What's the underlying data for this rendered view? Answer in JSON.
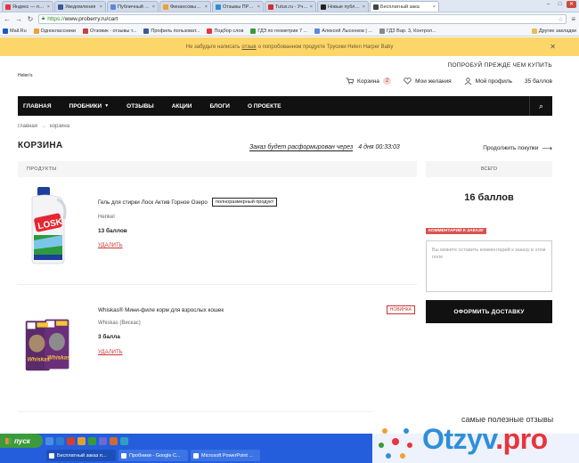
{
  "browser": {
    "tabs": [
      {
        "label": "Яндекс — поиск п",
        "color": "#e8343c",
        "active": false
      },
      {
        "label": "Уведомления",
        "color": "#3b5998",
        "active": false
      },
      {
        "label": "Публичный Старт",
        "color": "#5a8ad8",
        "active": false
      },
      {
        "label": "Финансовый фору",
        "color": "#f0a030",
        "active": false
      },
      {
        "label": "Отзывы ПРО - рос",
        "color": "#2f8fd8",
        "active": false
      },
      {
        "label": "Tutux.ru - Участн",
        "color": "#d03030",
        "active": false
      },
      {
        "label": "Новые публикаци",
        "color": "#222222",
        "active": false
      },
      {
        "label": "Бесплатный зака",
        "color": "#444444",
        "active": true
      }
    ],
    "url_protocol": "https://",
    "url_rest": "www.proberry.ru/cart",
    "bookmarks": [
      {
        "label": "Mail.Ru",
        "color": "#1a5bc4"
      },
      {
        "label": "Одноклассники",
        "color": "#f0a030"
      },
      {
        "label": "Отзовик - отзывы т...",
        "color": "#c84040"
      },
      {
        "label": "Профиль пользоват...",
        "color": "#3b5998"
      },
      {
        "label": "Подбор слов",
        "color": "#e8343c"
      },
      {
        "label": "ГДЗ по геометрии 7 ...",
        "color": "#3a9a3a"
      },
      {
        "label": "Алексей Лысенков | ...",
        "color": "#5a8ad8"
      },
      {
        "label": "ГДЗ Вар. 3, Контрол...",
        "color": "#888888"
      }
    ],
    "other_bookmarks": "Другие закладки"
  },
  "notice": {
    "before": "Не забудьте написать",
    "link": "отзыв",
    "after": "о попробованном продукте Трусики Helen Harper Baby"
  },
  "header": {
    "logo_text": "Helen's",
    "tagline": "ПОПРОБУЙ ПРЕЖДЕ ЧЕМ КУПИТЬ",
    "cart_label": "Корзина",
    "cart_count": "2",
    "wishlist_label": "Мои желания",
    "profile_label": "Мой профиль",
    "points_label": "35 баллов"
  },
  "nav": {
    "items": [
      "ГЛАВНАЯ",
      "ПРОБНИКИ",
      "ОТЗЫВЫ",
      "АКЦИИ",
      "БЛОГИ",
      "О ПРОЕКТЕ"
    ]
  },
  "breadcrumbs": [
    "главная",
    "корзина"
  ],
  "page": {
    "title": "КОРЗИНА",
    "timer_label": "Заказ будет расформирован через",
    "timer_value": "4 дня 00:33:03",
    "continue_label": "Продолжить покупки"
  },
  "products_header": "ПРОДУКТЫ",
  "products": [
    {
      "name": "Гель для стирки Лоск Актив Горное Озеро",
      "tag": "полноразмерный продукт",
      "brand": "Henkel",
      "points": "13 баллов",
      "remove": "УДАЛИТЬ"
    },
    {
      "name": "Whiskas® Мини-филе корм для взрослых кошек",
      "tag": "НОВИНКА",
      "brand": "Whiskas (Вискас)",
      "points": "3 балла",
      "remove": "УДАЛИТЬ"
    }
  ],
  "summary": {
    "header": "ВСЕГО",
    "total": "16 баллов",
    "comment_label": "КОММЕНТАРИЙ К ЗАКАЗУ",
    "comment_placeholder": "Вы можете оставить комментарий к заказу в этом поле",
    "order_button": "ОФОРМИТЬ ДОСТАВКУ"
  },
  "taskbar": {
    "start_label": "пуск",
    "windows": [
      {
        "label": "Бесплатный заказ п...",
        "active": true
      },
      {
        "label": "Пробники - Google C...",
        "active": false
      },
      {
        "label": "Microsoft PowerPoint ...",
        "active": false
      }
    ]
  },
  "watermark": {
    "slogan": "самые полезные отзывы",
    "brand_main": "Otzyv",
    "brand_suffix": ".pro"
  },
  "colors": {
    "notice_bg": "#fdd66a",
    "nav_bg": "#111111",
    "accent_red": "#d9534f",
    "taskbar_blue": "#245edc"
  }
}
